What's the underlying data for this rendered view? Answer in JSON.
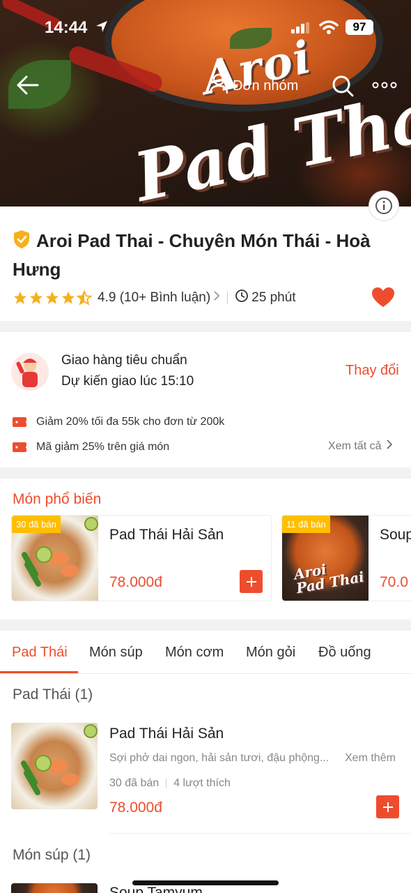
{
  "status_bar": {
    "time": "14:44",
    "battery": "97"
  },
  "hero": {
    "logo_line1": "Aroi",
    "logo_line2": "Pad Thai"
  },
  "header": {
    "group_order_label": "Đơn nhóm"
  },
  "shop": {
    "name": "Aroi Pad Thai - Chuyên Món Thái - Hoà Hưng",
    "rating": "4.9",
    "reviews": "(10+ Bình luận)",
    "delivery_time": "25 phút",
    "rating_stars": 4.5
  },
  "delivery": {
    "title": "Giao hàng tiêu chuẩn",
    "eta": "Dự kiến giao lúc 15:10",
    "change_label": "Thay đổi"
  },
  "promotions": [
    {
      "text": "Giảm 20% tối đa 55k cho đơn từ 200k"
    },
    {
      "text": "Mã giảm 25% trên giá món"
    }
  ],
  "see_all_label": "Xem tất cả",
  "popular": {
    "heading": "Món phổ biến",
    "items": [
      {
        "sold": "30 đã bán",
        "name": "Pad Thái Hải Sản",
        "price": "78.000đ"
      },
      {
        "sold": "11 đã bán",
        "name": "Soup",
        "price": "70.0"
      }
    ],
    "thumb_text_line1": "Aroi",
    "thumb_text_line2": "Pad Thai"
  },
  "tabs": [
    {
      "label": "Pad Thái",
      "active": true
    },
    {
      "label": "Món súp"
    },
    {
      "label": "Món cơm"
    },
    {
      "label": "Món gỏi"
    },
    {
      "label": "Đồ uống"
    }
  ],
  "menu": {
    "sections": [
      {
        "title": "Pad Thái (1)",
        "items": [
          {
            "name": "Pad Thái Hải Sản",
            "description": "Sợi phở dai ngon, hải sản tươi, đậu phộng...",
            "see_more": "Xem thêm",
            "sold": "30 đã bán",
            "likes": "4 lượt thích",
            "price": "78.000đ"
          }
        ]
      },
      {
        "title": "Món súp (1)",
        "items": [
          {
            "name": "Soup Tamyum"
          }
        ]
      }
    ]
  },
  "colors": {
    "accent": "#ee4d2d",
    "badge": "#ffbf00",
    "star": "#f6b01e",
    "heart": "#ee4d2d"
  }
}
